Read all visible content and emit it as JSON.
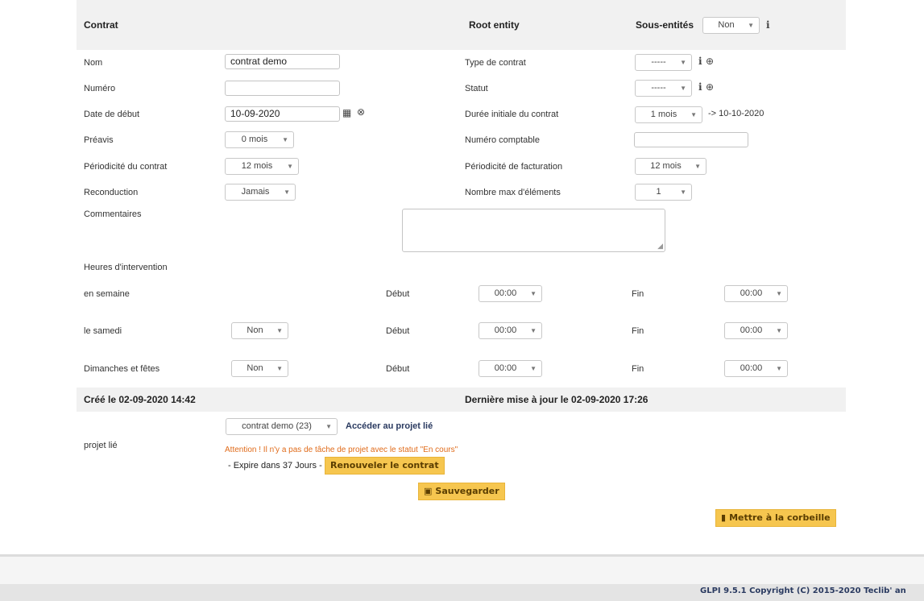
{
  "header": {
    "title": "Contrat",
    "entity": "Root entity",
    "sub_entities_label": "Sous-entités",
    "sub_entities_value": "Non"
  },
  "fields": {
    "nom_label": "Nom",
    "nom_value": "contrat demo",
    "numero_label": "Numéro",
    "numero_value": "",
    "date_debut_label": "Date de début",
    "date_debut_value": "10-09-2020",
    "preavis_label": "Préavis",
    "preavis_value": "0 mois",
    "periodicite_label": "Périodicité du contrat",
    "periodicite_value": "12 mois",
    "reconduction_label": "Reconduction",
    "reconduction_value": "Jamais",
    "commentaires_label": "Commentaires",
    "type_label": "Type de contrat",
    "type_value": "-----",
    "statut_label": "Statut",
    "statut_value": "-----",
    "duree_label": "Durée initiale du contrat",
    "duree_value": "1 mois",
    "duree_end": "-> 10-10-2020",
    "numero_comptable_label": "Numéro comptable",
    "numero_comptable_value": "",
    "facturation_label": "Périodicité de facturation",
    "facturation_value": "12 mois",
    "max_elements_label": "Nombre max d'éléments",
    "max_elements_value": "1"
  },
  "hours": {
    "section_label": "Heures d'intervention",
    "start_label": "Début",
    "end_label": "Fin",
    "rows": [
      {
        "label": "en semaine",
        "toggle": "",
        "start": "00:00",
        "end": "00:00"
      },
      {
        "label": "le samedi",
        "toggle": "Non",
        "start": "00:00",
        "end": "00:00"
      },
      {
        "label": "Dimanches et fêtes",
        "toggle": "Non",
        "start": "00:00",
        "end": "00:00"
      }
    ]
  },
  "footer": {
    "created": "Créé le 02-09-2020 14:42",
    "updated": "Dernière mise à jour le 02-09-2020 17:26"
  },
  "project": {
    "label": "projet lié",
    "select_value": "contrat demo (23)",
    "link": "Accéder au projet lié",
    "warning": "Attention ! Il n'y a pas de tâche de projet avec le statut \"En cours\"",
    "expire": "- Expire dans 37 Jours -",
    "renew_button": "Renouveler le contrat"
  },
  "actions": {
    "save": "Sauvegarder",
    "trash": "Mettre à la corbeille"
  },
  "page_footer": {
    "copyright": "GLPI 9.5.1 Copyright (C) 2015-2020 Teclib' an"
  },
  "colors": {
    "header_bg": "#f1f1f1",
    "button_bg": "#f6c64f",
    "warning": "#e06b1a",
    "footer_text": "#2a3a60"
  },
  "icons": {
    "info": "info-icon",
    "add": "plus-circle-icon",
    "calendar": "calendar-icon",
    "clear": "clear-circle-icon",
    "save": "floppy-icon",
    "trash": "trash-icon"
  }
}
